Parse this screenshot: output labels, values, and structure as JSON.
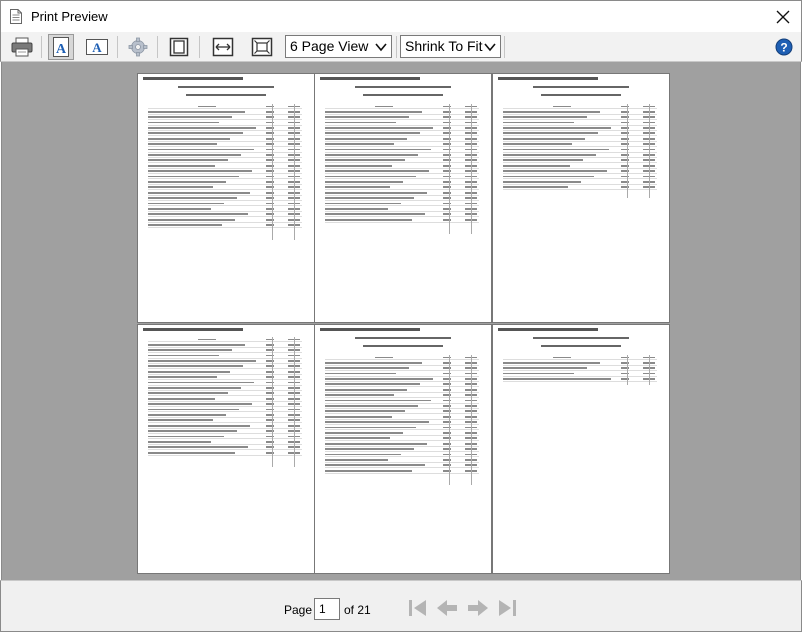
{
  "window": {
    "title": "Print Preview",
    "icons": {
      "app": "document-icon",
      "close": "close-icon"
    }
  },
  "toolbar": {
    "print": "printer-icon",
    "portrait": "portrait-font-icon",
    "landscape": "landscape-font-icon",
    "settings": "gear-icon",
    "one_page": "single-page-icon",
    "fit_width": "fit-width-icon",
    "fit_page": "fit-page-icon",
    "view_mode": "6 Page View",
    "scaling": "Shrink To Fit",
    "help": "help-icon"
  },
  "pages": [
    {
      "id": "p1",
      "rows": 23,
      "has_title": true
    },
    {
      "id": "p2",
      "rows": 22,
      "has_title": true
    },
    {
      "id": "p3",
      "rows": 16,
      "has_title": true
    },
    {
      "id": "p4",
      "rows": 22,
      "has_title": false
    },
    {
      "id": "p5",
      "rows": 22,
      "has_title": true
    },
    {
      "id": "p6",
      "rows": 5,
      "has_title": true
    }
  ],
  "navigation": {
    "page_label": "Page",
    "current_page": "1",
    "of_label": "of 21",
    "first": "first-page-icon",
    "prev": "previous-page-icon",
    "next": "next-page-icon",
    "last": "last-page-icon"
  },
  "colors": {
    "preview_bg": "#a0a0a0",
    "accent_blue": "#1e5fb4",
    "disabled_nav": "#b4b4b4"
  }
}
